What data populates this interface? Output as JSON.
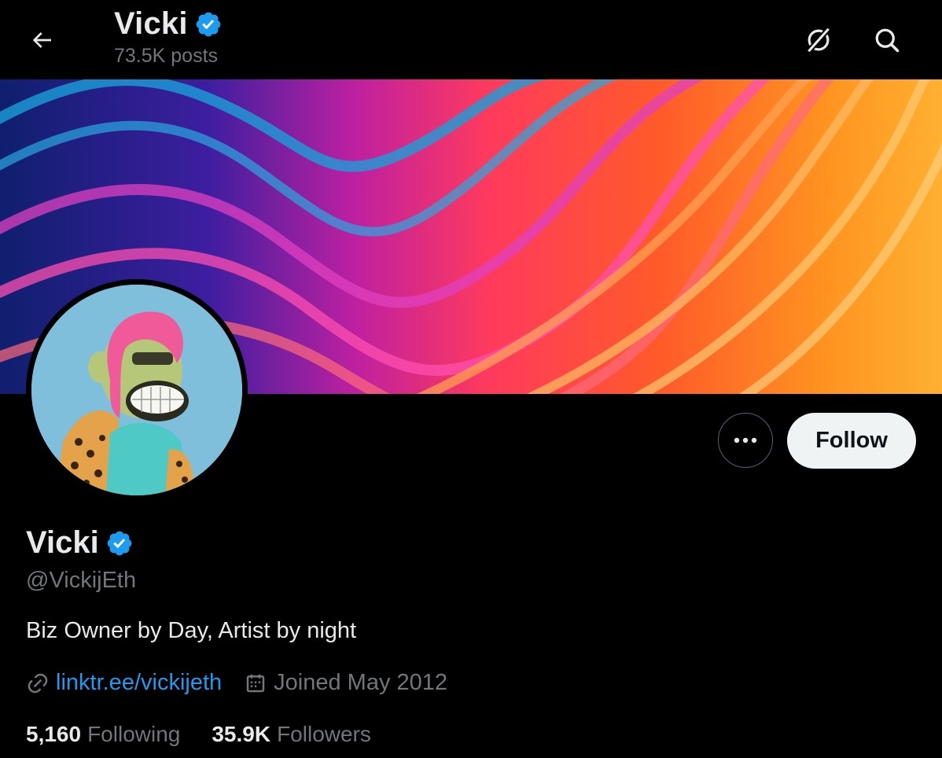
{
  "header": {
    "title": "Vicki",
    "posts_count": "73.5K posts",
    "back_icon": "arrow-left-icon",
    "grok_icon": "grok-icon",
    "search_icon": "search-icon"
  },
  "profile": {
    "display_name": "Vicki",
    "verified": true,
    "handle": "@VickijEth",
    "bio": "Biz Owner by Day, Artist by night",
    "link": "linktr.ee/vickijeth",
    "joined": "Joined May 2012",
    "following_count": "5,160",
    "following_label": "Following",
    "followers_count": "35.9K",
    "followers_label": "Followers"
  },
  "actions": {
    "more_icon": "more-icon",
    "follow_label": "Follow"
  },
  "colors": {
    "background": "#000000",
    "text_primary": "#e7e9ea",
    "text_secondary": "#71767b",
    "accent": "#1d9bf0",
    "follow_button_bg": "#eff3f4"
  }
}
